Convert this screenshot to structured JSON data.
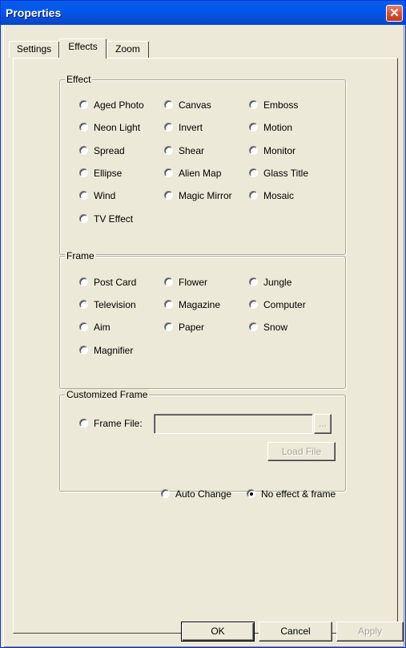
{
  "window": {
    "title": "Properties",
    "close_glyph": "✕"
  },
  "tabs": [
    {
      "label": "Settings",
      "active": false
    },
    {
      "label": "Effects",
      "active": true
    },
    {
      "label": "Zoom",
      "active": false
    }
  ],
  "effect_group": {
    "label": "Effect",
    "options": [
      "Aged Photo",
      "Canvas",
      "Emboss",
      "Neon Light",
      "Invert",
      "Motion",
      "Spread",
      "Shear",
      "Monitor",
      "Ellipse",
      "Alien Map",
      "Glass Title",
      "Wind",
      "Magic Mirror",
      "Mosaic",
      "TV Effect"
    ]
  },
  "frame_group": {
    "label": "Frame",
    "options": [
      "Post Card",
      "Flower",
      "Jungle",
      "Television",
      "Magazine",
      "Computer",
      "Aim",
      "Paper",
      "Snow",
      "Magnifier"
    ]
  },
  "custom_frame": {
    "label": "Customized Frame",
    "frame_file_label": "Frame File:",
    "frame_file_value": "",
    "browse_label": "...",
    "load_file_label": "Load File"
  },
  "mode": {
    "auto_change_label": "Auto Change",
    "no_effect_label": "No effect & frame",
    "selected": "No effect & frame"
  },
  "buttons": {
    "ok": "OK",
    "cancel": "Cancel",
    "apply": "Apply"
  }
}
